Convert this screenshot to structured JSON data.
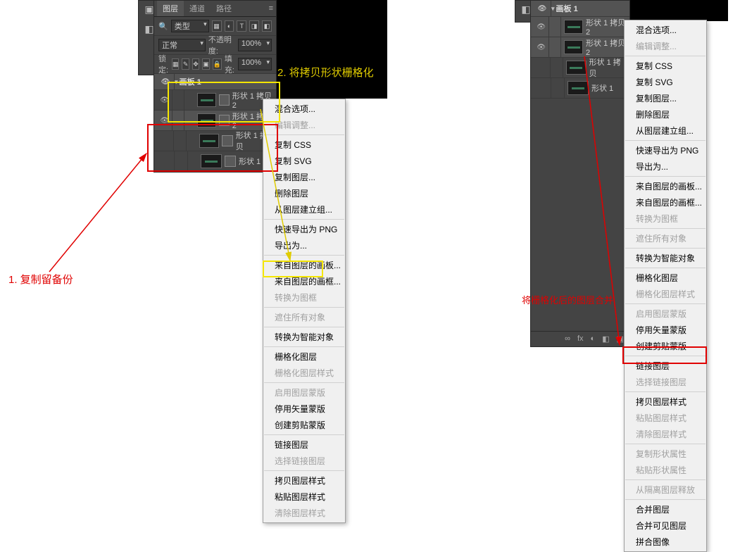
{
  "panel1": {
    "tabs": {
      "layers": "图层",
      "channels": "通道",
      "paths": "路径"
    },
    "filterType": "类型",
    "blendMode": "正常",
    "opacityLabel": "不透明度:",
    "opacityValue": "100%",
    "lockLabel": "锁定:",
    "fillLabel": "填充:",
    "fillValue": "100%",
    "artboard": "画板 1",
    "layers": [
      "形状 1 拷贝 2",
      "形状 1 拷贝 2",
      "形状 1 拷贝",
      "形状 1"
    ]
  },
  "panel2": {
    "artboard": "画板 1",
    "layers": [
      "形状 1 拷贝 2",
      "形状 1 拷贝 2",
      "形状 1 拷贝",
      "形状 1"
    ],
    "footerIcons": [
      "∞",
      "fx",
      "◐",
      "◧",
      "▣",
      "🗑"
    ]
  },
  "menu": {
    "items": [
      {
        "text": "混合选项...",
        "disabled": false
      },
      {
        "text": "编辑调整...",
        "disabled": true
      },
      "sep",
      {
        "text": "复制 CSS",
        "disabled": false
      },
      {
        "text": "复制 SVG",
        "disabled": false
      },
      {
        "text": "复制图层...",
        "disabled": false
      },
      {
        "text": "删除图层",
        "disabled": false
      },
      {
        "text": "从图层建立组...",
        "disabled": false
      },
      "sep",
      {
        "text": "快速导出为 PNG",
        "disabled": false
      },
      {
        "text": "导出为...",
        "disabled": false
      },
      "sep",
      {
        "text": "来自图层的画板...",
        "disabled": false
      },
      {
        "text": "来自图层的画框...",
        "disabled": false
      },
      {
        "text": "转换为图框",
        "disabled": true
      },
      "sep",
      {
        "text": "遮住所有对象",
        "disabled": true
      },
      "sep",
      {
        "text": "转换为智能对象",
        "disabled": false
      },
      "sep",
      {
        "text": "栅格化图层",
        "disabled": false
      },
      {
        "text": "栅格化图层样式",
        "disabled": true
      },
      "sep",
      {
        "text": "启用图层蒙版",
        "disabled": true
      },
      {
        "text": "停用矢量蒙版",
        "disabled": false
      },
      {
        "text": "创建剪贴蒙版",
        "disabled": false
      },
      "sep",
      {
        "text": "链接图层",
        "disabled": false
      },
      {
        "text": "选择链接图层",
        "disabled": true
      },
      "sep",
      {
        "text": "拷贝图层样式",
        "disabled": false
      },
      {
        "text": "粘贴图层样式",
        "disabled": false
      },
      {
        "text": "清除图层样式",
        "disabled": true
      }
    ]
  },
  "menu2": {
    "items": [
      {
        "text": "混合选项...",
        "disabled": false
      },
      {
        "text": "编辑调整...",
        "disabled": true
      },
      "sep",
      {
        "text": "复制 CSS",
        "disabled": false
      },
      {
        "text": "复制 SVG",
        "disabled": false
      },
      {
        "text": "复制图层...",
        "disabled": false
      },
      {
        "text": "删除图层",
        "disabled": false
      },
      {
        "text": "从图层建立组...",
        "disabled": false
      },
      "sep",
      {
        "text": "快速导出为 PNG",
        "disabled": false
      },
      {
        "text": "导出为...",
        "disabled": false
      },
      "sep",
      {
        "text": "来自图层的画板...",
        "disabled": false
      },
      {
        "text": "来自图层的画框...",
        "disabled": false
      },
      {
        "text": "转换为图框",
        "disabled": true
      },
      "sep",
      {
        "text": "遮住所有对象",
        "disabled": true
      },
      "sep",
      {
        "text": "转换为智能对象",
        "disabled": false
      },
      "sep",
      {
        "text": "栅格化图层",
        "disabled": false
      },
      {
        "text": "栅格化图层样式",
        "disabled": true
      },
      "sep",
      {
        "text": "启用图层蒙版",
        "disabled": true
      },
      {
        "text": "停用矢量蒙版",
        "disabled": false
      },
      {
        "text": "创建剪贴蒙版",
        "disabled": false
      },
      "sep",
      {
        "text": "链接图层",
        "disabled": false
      },
      {
        "text": "选择链接图层",
        "disabled": true
      },
      "sep",
      {
        "text": "拷贝图层样式",
        "disabled": false
      },
      {
        "text": "粘贴图层样式",
        "disabled": true
      },
      {
        "text": "清除图层样式",
        "disabled": true
      },
      "sep",
      {
        "text": "复制形状属性",
        "disabled": true
      },
      {
        "text": "粘贴形状属性",
        "disabled": true
      },
      "sep",
      {
        "text": "从隔离图层释放",
        "disabled": true
      },
      "sep",
      {
        "text": "合并图层",
        "disabled": false
      },
      {
        "text": "合并可见图层",
        "disabled": false
      },
      {
        "text": "拼合图像",
        "disabled": false
      }
    ]
  },
  "annotations": {
    "step1": "1. 复制留备份",
    "step2": "2. 将拷贝形状栅格化",
    "step3": "将栅格化后的图层合并"
  },
  "glyph": {
    "search": "🔍"
  }
}
